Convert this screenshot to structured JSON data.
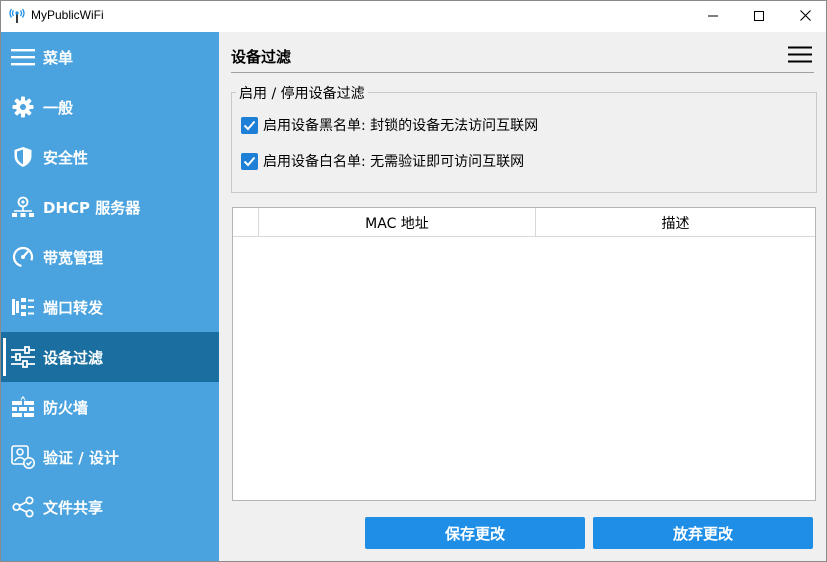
{
  "window": {
    "title": "MyPublicWiFi",
    "icons": {
      "app": "antenna-icon",
      "minimize": "minimize-icon",
      "maximize": "maximize-icon",
      "close": "close-icon"
    }
  },
  "sidebar": {
    "background": "#4aa3df",
    "active_background": "#1a6fa0",
    "items": [
      {
        "label": "菜单",
        "icon": "hamburger-icon"
      },
      {
        "label": "一般",
        "icon": "gear-icon"
      },
      {
        "label": "安全性",
        "icon": "shield-icon"
      },
      {
        "label": "DHCP 服务器",
        "icon": "network-icon"
      },
      {
        "label": "带宽管理",
        "icon": "speedometer-icon"
      },
      {
        "label": "端口转发",
        "icon": "port-icon"
      },
      {
        "label": "设备过滤",
        "icon": "sliders-icon",
        "active": true
      },
      {
        "label": "防火墙",
        "icon": "firewall-icon"
      },
      {
        "label": "验证 / 设计",
        "icon": "user-check-icon"
      },
      {
        "label": "文件共享",
        "icon": "share-icon"
      }
    ]
  },
  "main": {
    "title": "设备过滤",
    "group": {
      "legend": "启用 / 停用设备过滤",
      "blacklist_label": "启用设备黑名单: 封锁的设备无法访问互联网",
      "blacklist_checked": true,
      "whitelist_label": "启用设备白名单: 无需验证即可访问互联网",
      "whitelist_checked": true
    },
    "table": {
      "columns": [
        "",
        "MAC 地址",
        "描述"
      ],
      "rows": []
    },
    "buttons": {
      "save": "保存更改",
      "discard": "放弃更改"
    },
    "accent": "#1e8ee6"
  }
}
